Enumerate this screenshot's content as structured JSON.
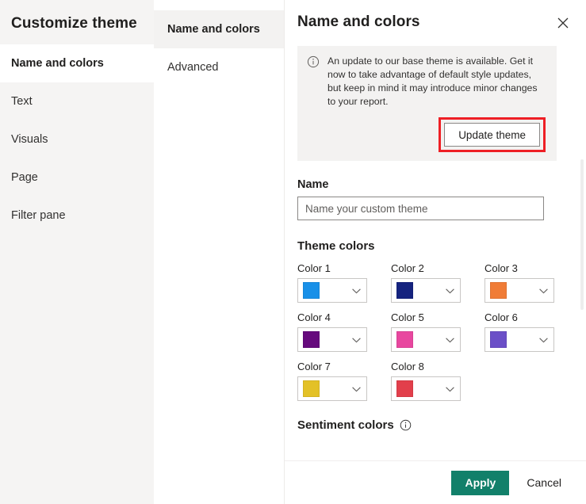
{
  "sidebar": {
    "title": "Customize theme",
    "items": [
      {
        "label": "Name and colors",
        "selected": true
      },
      {
        "label": "Text",
        "selected": false
      },
      {
        "label": "Visuals",
        "selected": false
      },
      {
        "label": "Page",
        "selected": false
      },
      {
        "label": "Filter pane",
        "selected": false
      }
    ]
  },
  "subnav": {
    "items": [
      {
        "label": "Name and colors",
        "selected": true
      },
      {
        "label": "Advanced",
        "selected": false
      }
    ]
  },
  "main": {
    "title": "Name and colors",
    "close_icon": "close-icon",
    "banner": {
      "icon": "info-icon",
      "message": "An update to our base theme is available. Get it now to take advantage of default style updates, but keep in mind it may introduce minor changes to your report.",
      "action_label": "Update theme",
      "highlight_color": "#ee1f25",
      "background": "#f3f2f1"
    },
    "name_field": {
      "label": "Name",
      "value": "",
      "placeholder": "Name your custom theme"
    },
    "theme_colors": {
      "title": "Theme colors",
      "swatches": [
        {
          "label": "Color 1",
          "color": "#1890e8"
        },
        {
          "label": "Color 2",
          "color": "#15237f"
        },
        {
          "label": "Color 3",
          "color": "#f07c36"
        },
        {
          "label": "Color 4",
          "color": "#660a7d"
        },
        {
          "label": "Color 5",
          "color": "#e8479f"
        },
        {
          "label": "Color 6",
          "color": "#6b4fc7"
        },
        {
          "label": "Color 7",
          "color": "#e3c127"
        },
        {
          "label": "Color 8",
          "color": "#e23f4b"
        }
      ]
    },
    "sentiment": {
      "title": "Sentiment colors",
      "info_icon": "info-icon"
    }
  },
  "footer": {
    "apply_label": "Apply",
    "cancel_label": "Cancel",
    "apply_color": "#12806a"
  }
}
